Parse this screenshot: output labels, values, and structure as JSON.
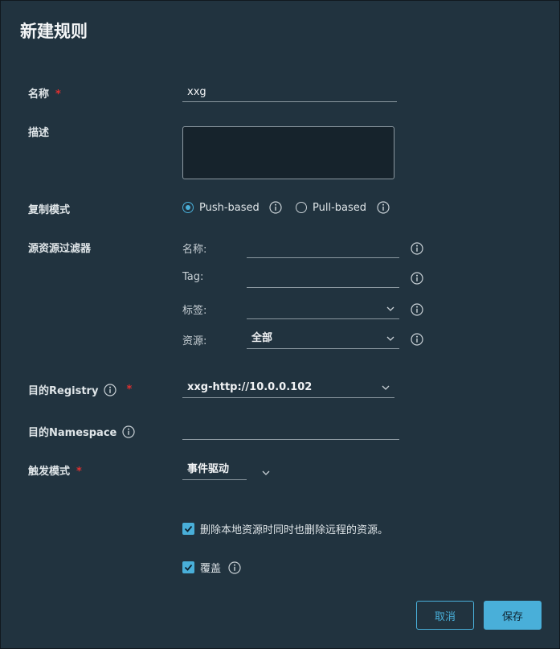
{
  "dialog": {
    "title": "新建规则"
  },
  "name": {
    "label": "名称",
    "required": "*",
    "value": "xxg"
  },
  "description": {
    "label": "描述",
    "value": ""
  },
  "replication_mode": {
    "label": "复制模式",
    "options": [
      {
        "label": "Push-based",
        "selected": true
      },
      {
        "label": "Pull-based",
        "selected": false
      }
    ]
  },
  "source_filter": {
    "label": "源资源过滤器",
    "name_label": "名称:",
    "name_value": "",
    "tag_label": "Tag:",
    "tag_value": "",
    "labels_label": "标签:",
    "labels_value": "",
    "resource_label": "资源:",
    "resource_value": "全部"
  },
  "dest_registry": {
    "label": "目的Registry",
    "required": "*",
    "value": "xxg-http://10.0.0.102"
  },
  "dest_namespace": {
    "label": "目的Namespace",
    "value": ""
  },
  "trigger_mode": {
    "label": "触发模式",
    "required": "*",
    "value": "事件驱动"
  },
  "options": {
    "delete_remote": {
      "label": "删除本地资源时同时也删除远程的资源。",
      "checked": true
    },
    "override": {
      "label": "覆盖",
      "checked": true
    }
  },
  "buttons": {
    "cancel": "取消",
    "save": "保存"
  },
  "colors": {
    "accent": "#49afd9",
    "background": "#21333f",
    "required": "#e1302f"
  }
}
